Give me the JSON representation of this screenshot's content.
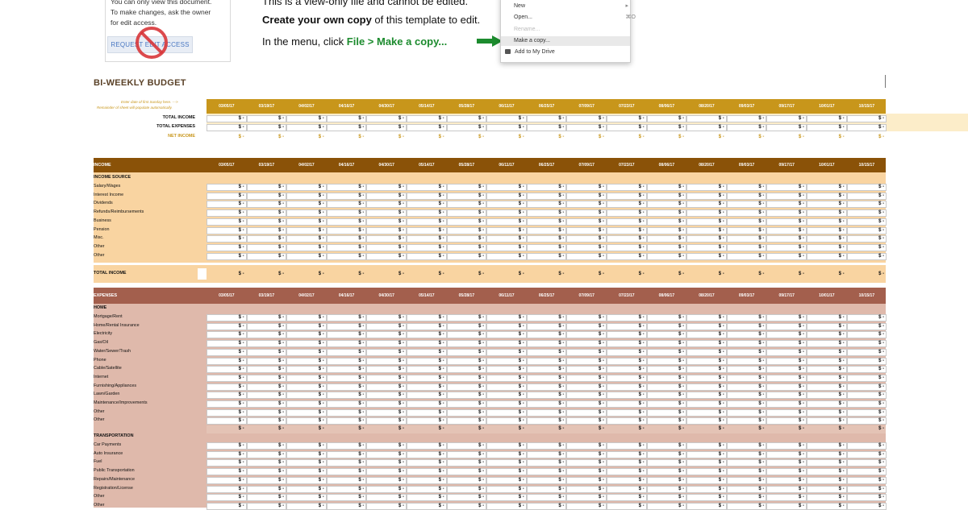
{
  "banner": {
    "notice_lines": [
      "You can only view this document.",
      "To make changes, ask the owner",
      "for edit access."
    ],
    "request_button": "REQUEST EDIT ACCESS",
    "instruction_1": "This is a view-only file and cannot be edited.",
    "instruction_2_bold": "Create your own copy",
    "instruction_2_rest": " of this template to edit.",
    "instruction_3_prefix": "In the menu, click ",
    "instruction_3_action": "File > Make a copy...",
    "menu": {
      "items": [
        {
          "label": "New",
          "shortcut": "▸"
        },
        {
          "label": "Open...",
          "shortcut": "⌘O"
        },
        {
          "label": "Rename...",
          "shortcut": ""
        },
        {
          "label": "Make a copy...",
          "shortcut": ""
        },
        {
          "label": "Add to My Drive",
          "shortcut": ""
        }
      ]
    }
  },
  "sheet": {
    "title": "BI-WEEKLY BUDGET",
    "hint_line_1": "Enter date of first Sunday here. --->",
    "hint_line_2": "Remainder of sheet will populate automatically.",
    "dates": [
      "03/05/17",
      "03/19/17",
      "04/02/17",
      "04/16/17",
      "04/30/17",
      "05/14/17",
      "05/28/17",
      "06/11/17",
      "06/25/17",
      "07/09/17",
      "07/23/17",
      "08/06/17",
      "08/20/17",
      "09/03/17",
      "09/17/17",
      "10/01/17",
      "10/15/17"
    ],
    "empty_value": "$ -",
    "summary": {
      "rows": [
        "TOTAL INCOME",
        "TOTAL EXPENSES"
      ],
      "net_label": "NET INCOME"
    },
    "income": {
      "header": "INCOME",
      "section": "INCOME SOURCE",
      "rows": [
        "Salary/Wages",
        "Interest Income",
        "Dividends",
        "Refunds/Reimbursements",
        "Business",
        "Pension",
        "Misc.",
        "Other",
        "Other"
      ],
      "total_label": "TOTAL INCOME"
    },
    "expenses": {
      "header": "EXPENSES",
      "home_section": "HOME",
      "home_rows": [
        "Mortgage/Rent",
        "Home/Rental Insurance",
        "Electricity",
        "Gas/Oil",
        "Water/Sewer/Trash",
        "Phone",
        "Cable/Satellite",
        "Internet",
        "Furnishing/Appliances",
        "Lawn/Garden",
        "Maintenance/Improvements",
        "Other",
        "Other"
      ],
      "transport_section": "TRANSPORTATION",
      "transport_rows": [
        "Car Payments",
        "Auto Insurance",
        "Fuel",
        "Public Transportation",
        "Repairs/Maintenance",
        "Registration/License",
        "Other",
        "Other"
      ]
    }
  },
  "colors": {
    "summary_header": "#c8961b",
    "summary_row": "#fcedc9",
    "net_income_text": "#c8961b",
    "income_header": "#8a5208",
    "income_row": "#f9d4a1",
    "expense_header": "#a35f4d",
    "expense_row": "#dfb9ab",
    "expense_subtotal": "#e4c3b5"
  }
}
